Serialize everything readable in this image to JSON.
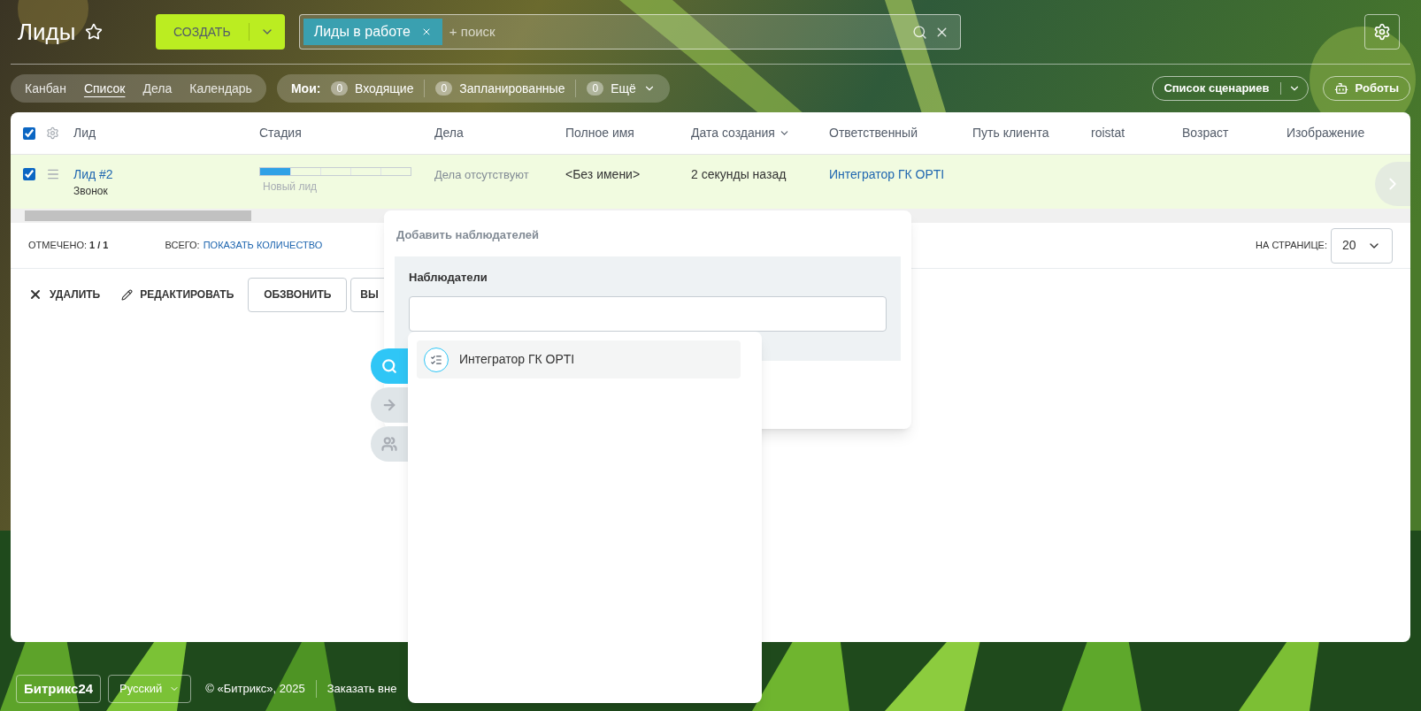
{
  "header": {
    "title": "Лиды",
    "create_button": "СОЗДАТЬ",
    "filter_tag": "Лиды в работе",
    "search_placeholder": "+ поиск"
  },
  "view_tabs": [
    {
      "label": "Канбан",
      "selected": false
    },
    {
      "label": "Список",
      "selected": true
    },
    {
      "label": "Дела",
      "selected": false
    },
    {
      "label": "Календарь",
      "selected": false
    }
  ],
  "counters": {
    "label": "Мои:",
    "items": [
      {
        "count": "0",
        "label": "Входящие"
      },
      {
        "count": "0",
        "label": "Запланированные"
      },
      {
        "count": "0",
        "label": "Ещё"
      }
    ]
  },
  "scenario_button": "Список сценариев",
  "robots_button": "Роботы",
  "table": {
    "all_checked": true,
    "columns": [
      {
        "label": "Лид",
        "sorted": false
      },
      {
        "label": "Стадия",
        "sorted": false
      },
      {
        "label": "Дела",
        "sorted": false
      },
      {
        "label": "Полное имя",
        "sorted": false
      },
      {
        "label": "Дата создания",
        "sorted": true
      },
      {
        "label": "Ответственный",
        "sorted": false
      },
      {
        "label": "Путь клиента",
        "sorted": false
      },
      {
        "label": "roistat",
        "sorted": false
      },
      {
        "label": "Возраст",
        "sorted": false
      },
      {
        "label": "Изображение",
        "sorted": false
      }
    ],
    "rows": [
      {
        "checked": true,
        "title": "Лид #2",
        "subtitle": "Звонок",
        "stage": {
          "level": 0.2,
          "label": "Новый лид"
        },
        "activities": "Дела отсутствуют",
        "full_name": "<Без имени>",
        "created": "2 секунды назад",
        "responsible": "Интегратор ГК OPTI"
      }
    ]
  },
  "summary": {
    "checked_label": "ОТМЕЧЕНО:",
    "checked_value": "1 / 1",
    "total_label": "ВСЕГО:",
    "total_link": "ПОКАЗАТЬ КОЛИЧЕСТВО",
    "per_page_label": "НА СТРАНИЦЕ:",
    "per_page_value": "20"
  },
  "actions": [
    {
      "kind": "delete",
      "label": "УДАЛИТЬ"
    },
    {
      "kind": "edit",
      "label": "РЕДАКТИРОВАТЬ"
    },
    {
      "kind": "outlined",
      "label": "ОБЗВОНИТЬ"
    },
    {
      "kind": "outlined",
      "label": "ВЫ"
    }
  ],
  "popup": {
    "title": "Добавить наблюдателей",
    "field_label": "Наблюдатели",
    "side_tabs": [
      {
        "kind": "search",
        "selected": true
      },
      {
        "kind": "arrow",
        "selected": false
      },
      {
        "kind": "people",
        "selected": false
      }
    ],
    "suggestions": [
      {
        "label": "Интегратор ГК OPTI"
      }
    ]
  },
  "footer": {
    "logo": "Битрикс24",
    "language": "Русский",
    "copyright": "© «Битрикс», 2025",
    "link": "Заказать вне"
  }
}
